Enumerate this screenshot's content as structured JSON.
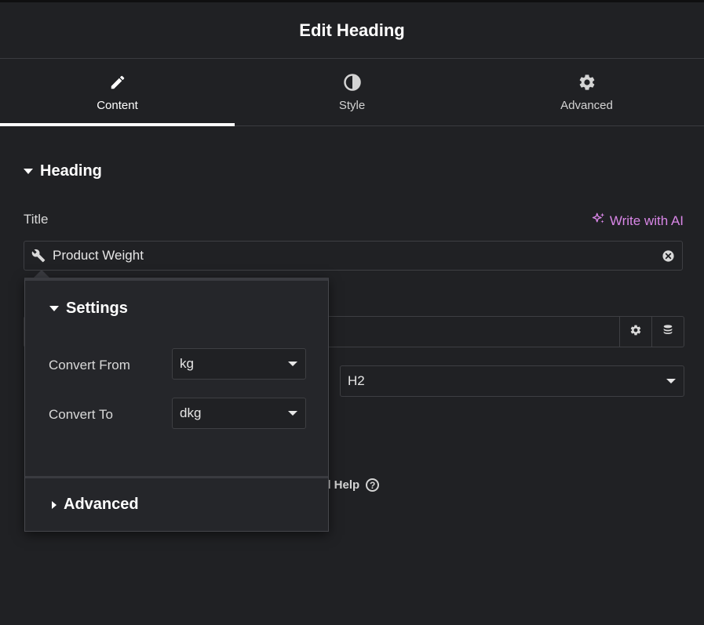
{
  "header": {
    "title": "Edit Heading"
  },
  "tabs": [
    {
      "label": "Content",
      "icon": "pencil-icon",
      "active": true
    },
    {
      "label": "Style",
      "icon": "half-circle-icon",
      "active": false
    },
    {
      "label": "Advanced",
      "icon": "gear-icon",
      "active": false
    }
  ],
  "section": {
    "title": "Heading"
  },
  "title_field": {
    "label": "Title",
    "ai_label": "Write with AI",
    "value": "Product Weight",
    "tag_icon": "wrench-icon"
  },
  "html_tag": {
    "value": "H2"
  },
  "help": {
    "label_partial": "ed Help",
    "icon": "?"
  },
  "popover": {
    "settings_title": "Settings",
    "convert_from": {
      "label": "Convert From",
      "value": "kg"
    },
    "convert_to": {
      "label": "Convert To",
      "value": "dkg"
    },
    "advanced_title": "Advanced"
  },
  "colors": {
    "background": "#202124",
    "accent_ai": "#d886e6",
    "text": "#e6e6e6"
  }
}
